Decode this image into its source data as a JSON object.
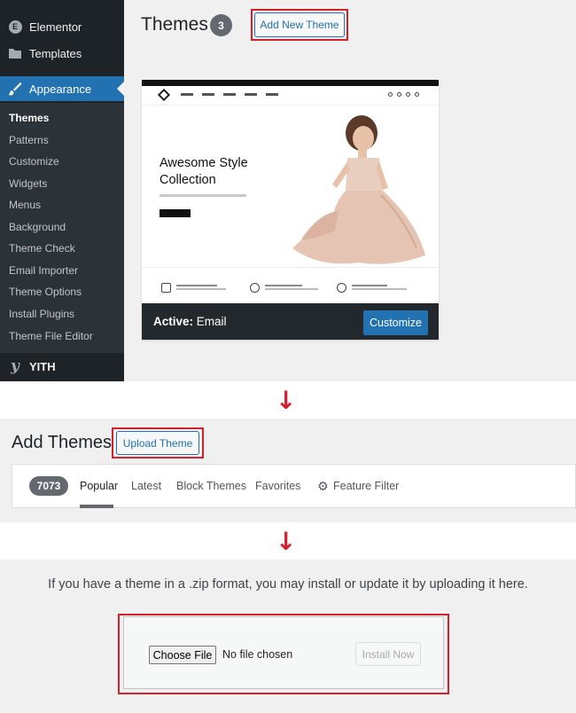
{
  "sidebar": {
    "top_items": [
      {
        "label": "Elementor",
        "icon": "elementor-icon"
      },
      {
        "label": "Templates",
        "icon": "folder-icon"
      },
      {
        "label": "Appearance",
        "icon": "paintbrush-icon"
      }
    ],
    "submenu": [
      "Themes",
      "Patterns",
      "Customize",
      "Widgets",
      "Menus",
      "Background",
      "Theme Check",
      "Email Importer",
      "Theme Options",
      "Install Plugins",
      "Theme File Editor"
    ],
    "bottom_item": {
      "label": "YITH",
      "icon": "yith-icon"
    }
  },
  "themes_page": {
    "title": "Themes",
    "count": "3",
    "add_new_label": "Add New Theme"
  },
  "theme_card": {
    "hero_title": "Awesome Style Collection",
    "active_prefix": "Active:",
    "active_name": "Email",
    "customize_label": "Customize"
  },
  "add_themes": {
    "title": "Add Themes",
    "upload_label": "Upload Theme",
    "count": "7073",
    "tabs": [
      "Popular",
      "Latest",
      "Block Themes",
      "Favorites"
    ],
    "feature_filter_label": "Feature Filter"
  },
  "upload": {
    "description": "If you have a theme in a .zip format, you may install or update it by uploading it here.",
    "choose_label": "Choose File",
    "no_file_label": "No file chosen",
    "install_label": "Install Now"
  },
  "colors": {
    "highlight": "#d6202a",
    "admin_blue": "#2271b1",
    "sidebar_bg": "#1d2327"
  }
}
